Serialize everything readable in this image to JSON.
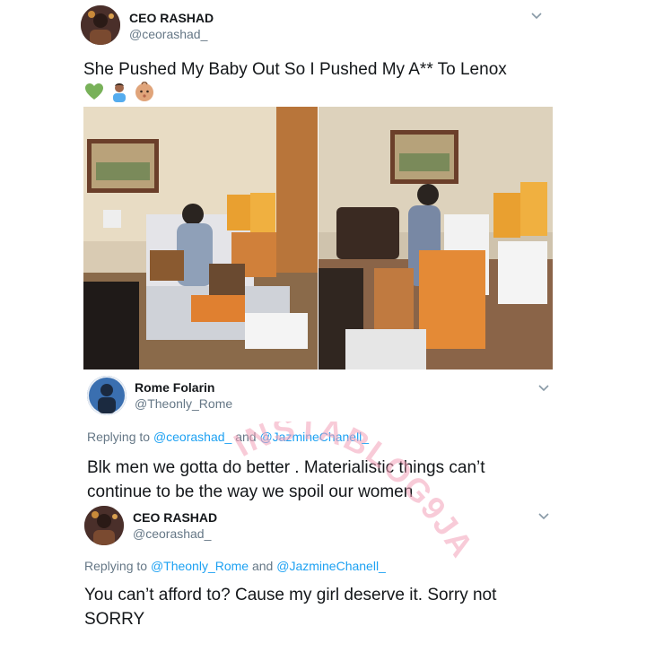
{
  "tweet1": {
    "name": "CEO RASHAD",
    "handle": "@ceorashad_",
    "text": "She Pushed My Baby Out So I Pushed My A** To Lenox",
    "emojis": [
      "green-heart-icon",
      "baby-boy-icon",
      "baby-face-icon"
    ]
  },
  "photos": [
    {
      "name": "hospital-room-photo-1"
    },
    {
      "name": "hospital-room-photo-2"
    }
  ],
  "tweet2": {
    "name": "Rome Folarin",
    "handle": "@Theonly_Rome",
    "replying_prefix": "Replying to",
    "mention1": "@ceorashad_",
    "and": "and",
    "mention2": "@JazmineChanell_",
    "text_line1": "Blk men we gotta do better . Materialistic things can’t",
    "text_line2": "continue to be the way we spoil our women"
  },
  "tweet3": {
    "name": "CEO RASHAD",
    "handle": "@ceorashad_",
    "replying_prefix": "Replying to",
    "mention1": "@Theonly_Rome",
    "and": "and",
    "mention2": "@JazmineChanell_",
    "text_line1": "You can’t afford to? Cause my girl deserve it. Sorry not",
    "text_line2": "SORRY"
  },
  "watermark": "INSTABLOG9JA",
  "colors": {
    "link": "#1da1f2",
    "secondary": "#657786",
    "text": "#14171a",
    "watermark": "#f2a0b8"
  }
}
